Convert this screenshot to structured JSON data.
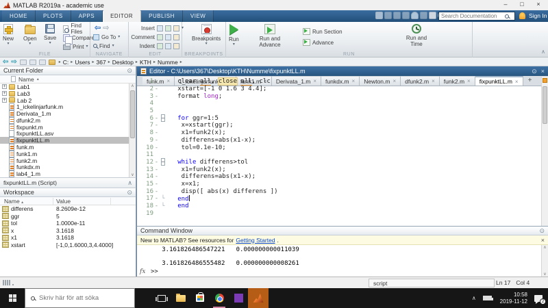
{
  "window": {
    "title": "MATLAB R2019a - academic use",
    "controls": {
      "minimize": "–",
      "maximize": "□",
      "close": "×"
    }
  },
  "ribbon": {
    "tabs": [
      {
        "label": "HOME"
      },
      {
        "label": "PLOTS"
      },
      {
        "label": "APPS"
      },
      {
        "label": "EDITOR",
        "active": true
      },
      {
        "label": "PUBLISH"
      },
      {
        "label": "VIEW"
      }
    ],
    "quick_access": [
      "save",
      "cut",
      "copy",
      "paste",
      "undo",
      "redo",
      "print",
      "help",
      "community"
    ],
    "search_placeholder": "Search Documentation",
    "sign_in": "Sign In",
    "groups": {
      "file": {
        "label": "FILE",
        "new": "New",
        "open": "Open",
        "save": "Save",
        "find_files": "Find Files",
        "compare": "Compare",
        "print": "Print"
      },
      "navigate": {
        "label": "NAVIGATE",
        "goto": "Go To",
        "find": "Find"
      },
      "edit": {
        "label": "EDIT",
        "insert": "Insert",
        "comment": "Comment",
        "indent": "Indent"
      },
      "breakpoints": {
        "label": "BREAKPOINTS",
        "breakpoints": "Breakpoints"
      },
      "run": {
        "label": "RUN",
        "run": "Run",
        "run_and_advance": "Run and Advance",
        "run_section": "Run Section",
        "advance": "Advance",
        "run_and_time": "Run and Time"
      }
    }
  },
  "pathbar": {
    "crumbs": [
      "C:",
      "Users",
      "367",
      "Desktop",
      "KTH",
      "Numme"
    ]
  },
  "current_folder": {
    "title": "Current Folder",
    "name_col": "Name",
    "items": [
      {
        "name": "Lab1",
        "type": "folder",
        "expander": true
      },
      {
        "name": "Lab3",
        "type": "folder",
        "expander": true
      },
      {
        "name": "Lab 2",
        "type": "folder",
        "expander": true
      },
      {
        "name": "1_ickelinjarfunk.m",
        "type": "mfile"
      },
      {
        "name": "Derivata_1.m",
        "type": "mfile"
      },
      {
        "name": "dfunk2.m",
        "type": "mfile"
      },
      {
        "name": "fixpunkt.m",
        "type": "mfile"
      },
      {
        "name": "fixpunktLL.asv",
        "type": "plain"
      },
      {
        "name": "fixpunktLL.m",
        "type": "mfile",
        "selected": true
      },
      {
        "name": "funk.m",
        "type": "mfile"
      },
      {
        "name": "funk1.m",
        "type": "mfile"
      },
      {
        "name": "funk2.m",
        "type": "mfile"
      },
      {
        "name": "funkdx.m",
        "type": "mfile"
      },
      {
        "name": "lab4_1.m",
        "type": "mfile"
      }
    ],
    "details": "fixpunktLL.m (Script)"
  },
  "workspace": {
    "title": "Workspace",
    "col_name": "Name",
    "col_value": "Value",
    "rows": [
      {
        "name": "differens",
        "value": "8.2609e-12"
      },
      {
        "name": "ggr",
        "value": "5"
      },
      {
        "name": "tol",
        "value": "1.0000e-11"
      },
      {
        "name": "x",
        "value": "3.1618"
      },
      {
        "name": "x1",
        "value": "3.1618"
      },
      {
        "name": "xstart",
        "value": "[-1,0,1.6000,3,4.4000]"
      }
    ]
  },
  "editor": {
    "title": "Editor - C:\\Users\\367\\Desktop\\KTH\\Numme\\fixpunktLL.m",
    "tabs": [
      {
        "label": "funk.m"
      },
      {
        "label": "1_ickelinjarfunk.m"
      },
      {
        "label": "funk1.m"
      },
      {
        "label": "Derivata_1.m"
      },
      {
        "label": "funkdx.m"
      },
      {
        "label": "Newton.m"
      },
      {
        "label": "dfunk2.m"
      },
      {
        "label": "funk2.m"
      },
      {
        "label": "fixpunktLL.m",
        "active": true
      }
    ],
    "new_tab": "+",
    "lines": [
      {
        "n": "1",
        "d": true,
        "fold": "",
        "seg": [
          [
            "   clear "
          ],
          [
            "all",
            "w"
          ],
          [
            ", "
          ],
          [
            "close",
            "hl"
          ],
          [
            " "
          ],
          [
            "all",
            "w"
          ],
          [
            ", clc"
          ]
        ]
      },
      {
        "n": "2",
        "d": true,
        "fold": "",
        "seg": [
          [
            "   xstart=[-1 0 1.6 3 4.4];"
          ]
        ]
      },
      {
        "n": "3",
        "d": true,
        "fold": "",
        "seg": [
          [
            "   format "
          ],
          [
            "long",
            "p"
          ],
          [
            ";"
          ]
        ]
      },
      {
        "n": "4",
        "d": false,
        "fold": "",
        "seg": []
      },
      {
        "n": "5",
        "d": false,
        "fold": "",
        "seg": []
      },
      {
        "n": "6",
        "d": true,
        "fold": "box",
        "seg": [
          [
            "   "
          ],
          [
            "for",
            "k"
          ],
          [
            " ggr=1:5"
          ]
        ]
      },
      {
        "n": "7",
        "d": true,
        "fold": "",
        "seg": [
          [
            "    x=xstart(ggr);"
          ]
        ]
      },
      {
        "n": "8",
        "d": true,
        "fold": "",
        "seg": [
          [
            "    x1=funk2(x);"
          ]
        ]
      },
      {
        "n": "9",
        "d": true,
        "fold": "",
        "seg": [
          [
            "    differens=abs(x1-x);"
          ]
        ]
      },
      {
        "n": "10",
        "d": true,
        "fold": "",
        "seg": [
          [
            "    tol=0.1e-10;"
          ]
        ]
      },
      {
        "n": "11",
        "d": false,
        "fold": "",
        "seg": []
      },
      {
        "n": "12",
        "d": true,
        "fold": "box",
        "seg": [
          [
            "   "
          ],
          [
            "while",
            "k"
          ],
          [
            " differens>tol"
          ]
        ]
      },
      {
        "n": "13",
        "d": true,
        "fold": "",
        "seg": [
          [
            "    x1=funk2(x);"
          ]
        ]
      },
      {
        "n": "14",
        "d": true,
        "fold": "",
        "seg": [
          [
            "    differens=abs(x1-x);"
          ]
        ]
      },
      {
        "n": "15",
        "d": true,
        "fold": "",
        "seg": [
          [
            "    x=x1;"
          ]
        ]
      },
      {
        "n": "16",
        "d": true,
        "fold": "",
        "seg": [
          [
            "    disp([ abs(x) differens ])"
          ]
        ]
      },
      {
        "n": "17",
        "d": true,
        "fold": "end",
        "seg": [
          [
            "   "
          ],
          [
            "end",
            "k"
          ]
        ],
        "caret": true
      },
      {
        "n": "18",
        "d": true,
        "fold": "end",
        "seg": [
          [
            "   "
          ],
          [
            "end",
            "k"
          ]
        ]
      },
      {
        "n": "19",
        "d": false,
        "fold": "",
        "seg": []
      }
    ]
  },
  "command_window": {
    "title": "Command Window",
    "banner_prefix": "New to MATLAB? See resources for ",
    "banner_link": "Getting Started",
    "banner_suffix": ".",
    "output": [
      "   3.161826486547221   0.000000000011039",
      "",
      "   3.161826486555482   0.000000000008261"
    ],
    "prompt": ">>",
    "fx": "fx"
  },
  "status_bar": {
    "mode": "script",
    "ln_label": "Ln",
    "ln": "17",
    "col_label": "Col",
    "col": "4"
  },
  "taskbar": {
    "search_placeholder": "Skriv här för att söka",
    "icons": [
      "task-view",
      "file-explorer",
      "store",
      "chrome",
      "app-purple",
      "matlab"
    ],
    "time": "10:58",
    "date": "2019-11-12",
    "notification_count": "2"
  }
}
